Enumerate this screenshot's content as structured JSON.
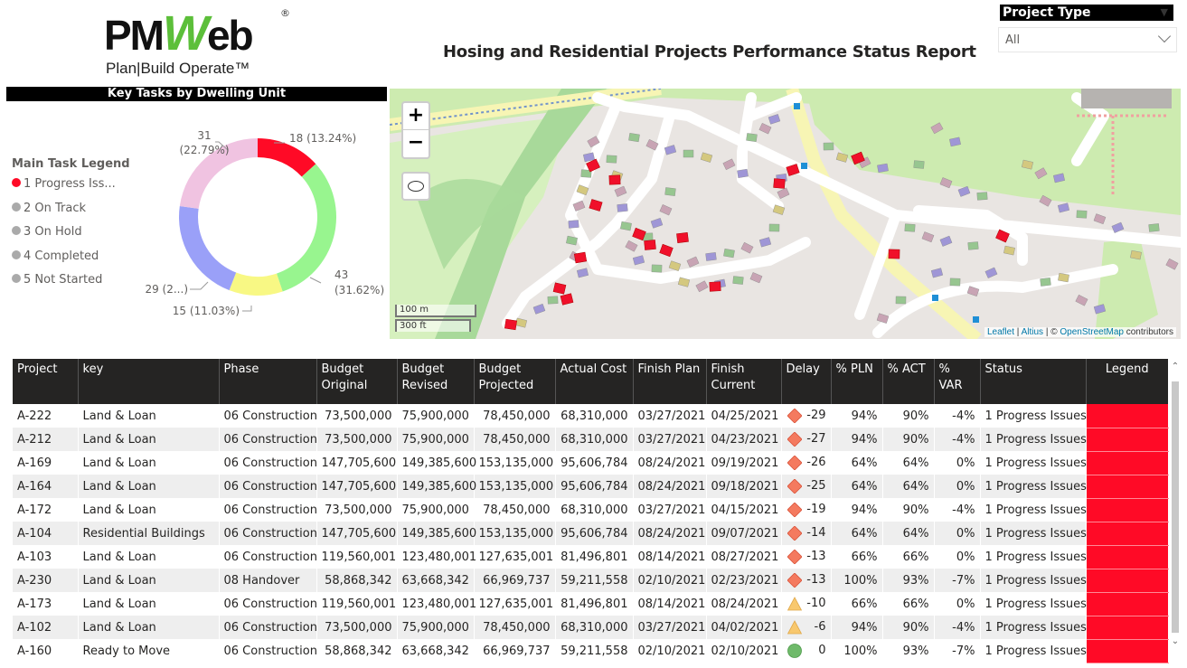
{
  "logo": {
    "brand_prefix": "PM",
    "brand_w": "W",
    "brand_suffix": "eb",
    "registered": "®",
    "tagline": "Plan|Build Operate™"
  },
  "header": {
    "title": "Hosing and Residential Projects Performance Status Report"
  },
  "slicer": {
    "label": "Project Type",
    "value": "All"
  },
  "donut_panel": {
    "title": "Key Tasks by Dwelling Unit",
    "legend_title": "Main Task Legend",
    "legend": [
      {
        "label": "1 Progress Iss...",
        "color": "#ff0a26"
      },
      {
        "label": "2 On Track",
        "color": "#aaaaaa"
      },
      {
        "label": "3 On Hold",
        "color": "#aaaaaa"
      },
      {
        "label": "4 Completed",
        "color": "#aaaaaa"
      },
      {
        "label": "5 Not Started",
        "color": "#aaaaaa"
      }
    ]
  },
  "chart_data": {
    "type": "pie",
    "subtype": "donut",
    "title": "Key Tasks by Dwelling Unit",
    "legend_title": "Main Task Legend",
    "legend_position": "left",
    "categories": [
      "1 Progress Issues",
      "2 On Track",
      "3 On Hold",
      "4 Completed",
      "5 Not Started"
    ],
    "values": [
      18,
      43,
      15,
      29,
      31
    ],
    "percentages": [
      13.24,
      31.62,
      11.03,
      21.32,
      22.79
    ],
    "colors": [
      "#ff0a26",
      "#98f58f",
      "#f8f884",
      "#9aa0f8",
      "#f0c3e1"
    ],
    "data_labels": [
      "18 (13.24%)",
      "43\n(31.62%)",
      "15 (11.03%)",
      "29 (2...)",
      "31\n(22.79%)"
    ]
  },
  "map": {
    "zoom_in": "+",
    "zoom_out": "−",
    "scale_metric": "100 m",
    "scale_imperial": "300 ft",
    "attribution": {
      "leaflet": "Leaflet",
      "sep1": " | ",
      "altius": "Altius",
      "sep2": " | © ",
      "osm": "OpenStreetMap",
      "suffix": " contributors"
    }
  },
  "table": {
    "columns": [
      "Project",
      "key",
      "Phase",
      "Budget Original",
      "Budget Revised",
      "Budget Projected",
      "Actual Cost",
      "Finish Plan",
      "Finish Current",
      "Delay",
      "% PLN",
      "% ACT",
      "% VAR",
      "Status",
      "Legend"
    ],
    "sorted_column": "Delay",
    "sort_direction": "ascending",
    "legend_color": "#ff0a26",
    "rows": [
      {
        "project": "A-222",
        "key": "Land & Loan",
        "phase": "06 Construction",
        "budget_original": "73,500,000",
        "budget_revised": "75,900,000",
        "budget_projected": "78,450,000",
        "actual_cost": "68,310,000",
        "finish_plan": "03/27/2021",
        "finish_current": "04/25/2021",
        "delay_icon": "diamond",
        "delay": "-29",
        "pln": "94%",
        "act": "90%",
        "var": "-4%",
        "status": "1 Progress Issues"
      },
      {
        "project": "A-212",
        "key": "Land & Loan",
        "phase": "06 Construction",
        "budget_original": "73,500,000",
        "budget_revised": "75,900,000",
        "budget_projected": "78,450,000",
        "actual_cost": "68,310,000",
        "finish_plan": "03/27/2021",
        "finish_current": "04/23/2021",
        "delay_icon": "diamond",
        "delay": "-27",
        "pln": "94%",
        "act": "90%",
        "var": "-4%",
        "status": "1 Progress Issues"
      },
      {
        "project": "A-169",
        "key": "Land & Loan",
        "phase": "06 Construction",
        "budget_original": "147,705,600",
        "budget_revised": "149,385,600",
        "budget_projected": "153,135,000",
        "actual_cost": "95,606,784",
        "finish_plan": "08/24/2021",
        "finish_current": "09/19/2021",
        "delay_icon": "diamond",
        "delay": "-26",
        "pln": "64%",
        "act": "64%",
        "var": "0%",
        "status": "1 Progress Issues"
      },
      {
        "project": "A-164",
        "key": "Land & Loan",
        "phase": "06 Construction",
        "budget_original": "147,705,600",
        "budget_revised": "149,385,600",
        "budget_projected": "153,135,000",
        "actual_cost": "95,606,784",
        "finish_plan": "08/24/2021",
        "finish_current": "09/18/2021",
        "delay_icon": "diamond",
        "delay": "-25",
        "pln": "64%",
        "act": "64%",
        "var": "0%",
        "status": "1 Progress Issues"
      },
      {
        "project": "A-172",
        "key": "Land & Loan",
        "phase": "06 Construction",
        "budget_original": "73,500,000",
        "budget_revised": "75,900,000",
        "budget_projected": "78,450,000",
        "actual_cost": "68,310,000",
        "finish_plan": "03/27/2021",
        "finish_current": "04/15/2021",
        "delay_icon": "diamond",
        "delay": "-19",
        "pln": "94%",
        "act": "90%",
        "var": "-4%",
        "status": "1 Progress Issues"
      },
      {
        "project": "A-104",
        "key": "Residential Buildings",
        "phase": "06 Construction",
        "budget_original": "147,705,600",
        "budget_revised": "149,385,600",
        "budget_projected": "153,135,000",
        "actual_cost": "95,606,784",
        "finish_plan": "08/24/2021",
        "finish_current": "09/07/2021",
        "delay_icon": "diamond",
        "delay": "-14",
        "pln": "64%",
        "act": "64%",
        "var": "0%",
        "status": "1 Progress Issues"
      },
      {
        "project": "A-103",
        "key": "Land & Loan",
        "phase": "06 Construction",
        "budget_original": "119,560,001",
        "budget_revised": "123,480,001",
        "budget_projected": "127,635,001",
        "actual_cost": "81,496,801",
        "finish_plan": "08/14/2021",
        "finish_current": "08/27/2021",
        "delay_icon": "diamond",
        "delay": "-13",
        "pln": "66%",
        "act": "66%",
        "var": "0%",
        "status": "1 Progress Issues"
      },
      {
        "project": "A-230",
        "key": "Land & Loan",
        "phase": "08 Handover",
        "budget_original": "58,868,342",
        "budget_revised": "63,668,342",
        "budget_projected": "66,969,737",
        "actual_cost": "59,211,558",
        "finish_plan": "02/10/2021",
        "finish_current": "02/23/2021",
        "delay_icon": "diamond",
        "delay": "-13",
        "pln": "100%",
        "act": "93%",
        "var": "-7%",
        "status": "1 Progress Issues"
      },
      {
        "project": "A-173",
        "key": "Land & Loan",
        "phase": "06 Construction",
        "budget_original": "119,560,001",
        "budget_revised": "123,480,001",
        "budget_projected": "127,635,001",
        "actual_cost": "81,496,801",
        "finish_plan": "08/14/2021",
        "finish_current": "08/24/2021",
        "delay_icon": "triangle",
        "delay": "-10",
        "pln": "66%",
        "act": "66%",
        "var": "0%",
        "status": "1 Progress Issues"
      },
      {
        "project": "A-102",
        "key": "Land & Loan",
        "phase": "06 Construction",
        "budget_original": "73,500,000",
        "budget_revised": "75,900,000",
        "budget_projected": "78,450,000",
        "actual_cost": "68,310,000",
        "finish_plan": "03/27/2021",
        "finish_current": "04/02/2021",
        "delay_icon": "triangle",
        "delay": "-6",
        "pln": "94%",
        "act": "90%",
        "var": "-4%",
        "status": "1 Progress Issues"
      },
      {
        "project": "A-160",
        "key": "Ready to Move",
        "phase": "06 Construction",
        "budget_original": "58,868,342",
        "budget_revised": "63,668,342",
        "budget_projected": "66,969,737",
        "actual_cost": "59,211,558",
        "finish_plan": "02/10/2021",
        "finish_current": "02/10/2021",
        "delay_icon": "circle",
        "delay": "0",
        "pln": "100%",
        "act": "93%",
        "var": "-7%",
        "status": "1 Progress Issues"
      }
    ]
  },
  "kpi_colors": {
    "diamond": "#f47a5f",
    "triangle": "#f8c86e",
    "circle": "#6fba6a"
  }
}
